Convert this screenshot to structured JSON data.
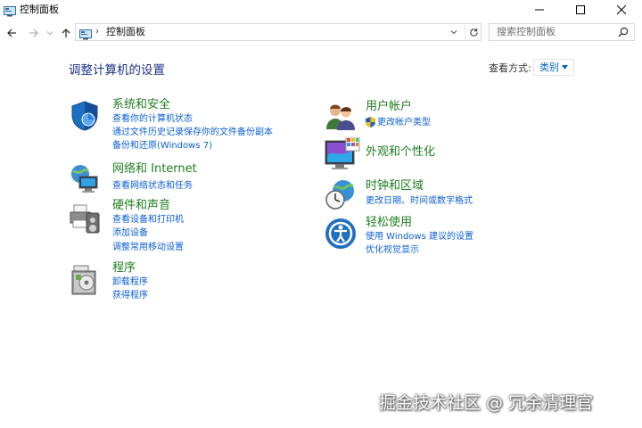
{
  "window": {
    "title": "控制面板",
    "controls": [
      "minimize-icon",
      "maximize-icon",
      "close-icon"
    ]
  },
  "navigation": {
    "buttons": [
      "back-arrow-icon",
      "forward-arrow-icon",
      "chevron-down-icon",
      "up-arrow-icon"
    ],
    "address": {
      "separator": "›",
      "path": "控制面板"
    },
    "search_placeholder": "搜索控制面板"
  },
  "main": {
    "heading": "调整计算机的设置",
    "view_by": {
      "label": "查看方式:",
      "value": "类别"
    }
  },
  "categories_left": [
    {
      "icon": "shield-icon",
      "title": "系统和安全",
      "links": [
        "查看你的计算机状态",
        "通过文件历史记录保存你的文件备份副本",
        "备份和还原(Windows 7)"
      ]
    },
    {
      "icon": "globe-network-icon",
      "title": "网络和 Internet",
      "links": [
        "查看网络状态和任务"
      ]
    },
    {
      "icon": "printer-icon",
      "title": "硬件和声音",
      "links": [
        "查看设备和打印机",
        "添加设备",
        "调整常用移动设置"
      ]
    },
    {
      "icon": "programs-icon",
      "title": "程序",
      "links": [
        "卸载程序",
        "获得程序"
      ]
    }
  ],
  "categories_right": [
    {
      "icon": "users-icon",
      "title": "用户帐户",
      "links": [
        "更改帐户类型"
      ]
    },
    {
      "icon": "appearance-icon",
      "title": "外观和个性化",
      "links": []
    },
    {
      "icon": "clock-globe-icon",
      "title": "时钟和区域",
      "links": [
        "更改日期、时间或数字格式"
      ]
    },
    {
      "icon": "ease-of-access-icon",
      "title": "轻松使用",
      "links": [
        "使用 Windows 建议的设置",
        "优化视觉显示"
      ]
    }
  ],
  "watermark": "掘金技术社区 @ 冗余清理官",
  "colors": {
    "heading": "#1e3287",
    "category_title": "#1e7e1e",
    "link": "#0b5ed7",
    "selected_value": "#0066cc"
  }
}
